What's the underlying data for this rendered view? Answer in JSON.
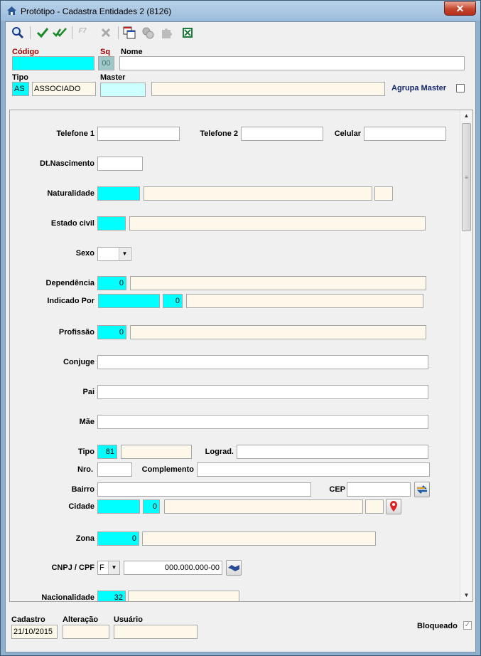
{
  "window": {
    "title": "Protótipo - Cadastra Entidades 2 (8126)",
    "close_glyph": "✕"
  },
  "toolbar": {
    "f7_label": "F7"
  },
  "header": {
    "codigo_label": "Código",
    "codigo_value": "",
    "sq_label": "Sq",
    "sq_value": "00",
    "nome_label": "Nome",
    "nome_value": "",
    "tipo_label": "Tipo",
    "tipo_code": "AS",
    "tipo_desc": "ASSOCIADO",
    "master_label": "Master",
    "master_code": "",
    "master_desc": "",
    "agrupa_label": "Agrupa Master"
  },
  "form": {
    "telefone1_label": "Telefone 1",
    "telefone2_label": "Telefone 2",
    "celular_label": "Celular",
    "dtnasc_label": "Dt.Nascimento",
    "naturalidade_label": "Naturalidade",
    "estadocivil_label": "Estado civil",
    "sexo_label": "Sexo",
    "sexo_value": "",
    "dependencia_label": "Dependência",
    "dependencia_code": "0",
    "indicado_label": "Indicado Por",
    "indicado_code": "0",
    "profissao_label": "Profissão",
    "profissao_code": "0",
    "conjuge_label": "Conjuge",
    "pai_label": "Pai",
    "mae_label": "Mãe",
    "tipo_label": "Tipo",
    "tipo_code": "81",
    "lograd_label": "Lograd.",
    "nro_label": "Nro.",
    "complemento_label": "Complemento",
    "bairro_label": "Bairro",
    "cep_label": "CEP",
    "cidade_label": "Cidade",
    "cidade_code": "0",
    "zona_label": "Zona",
    "zona_code": "0",
    "cnpj_label": "CNPJ / CPF",
    "cnpj_type": "F",
    "cnpj_value": "000.000.000-00",
    "nacionalidade_label": "Nacionalidade",
    "nacionalidade_code": "32"
  },
  "bottom": {
    "cadastro_label": "Cadastro",
    "cadastro_value": "21/10/2015",
    "alteracao_label": "Alteração",
    "alteracao_value": "",
    "usuario_label": "Usuário",
    "usuario_value": "",
    "bloqueado_label": "Bloqueado",
    "bloqueado_glyph": "✓"
  },
  "colors": {
    "required_cyan": "#00ffff",
    "readonly_beige": "#fdf8ea",
    "label_red": "#a00000",
    "label_navy": "#14286e"
  }
}
